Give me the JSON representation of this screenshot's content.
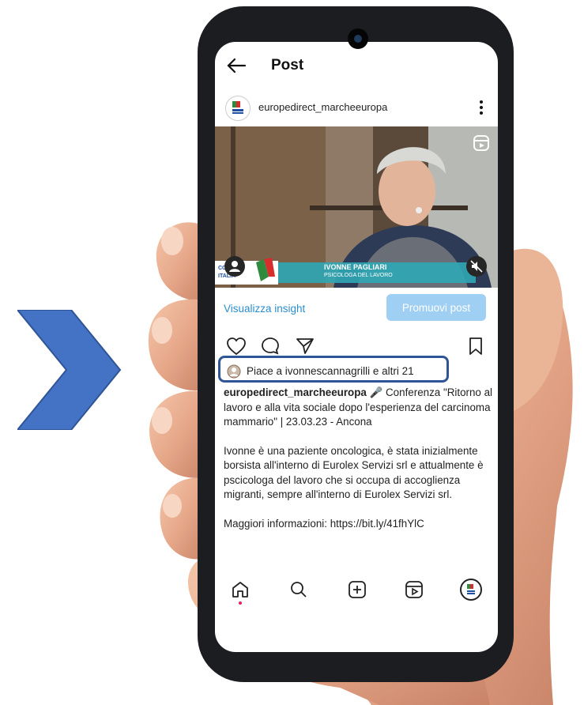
{
  "header": {
    "title": "Post"
  },
  "post": {
    "username": "europedirect_marcheeuropa",
    "video": {
      "lower_third_name": "IVONNE PAGLIARI",
      "lower_third_role": "PSICOLOGA DEL LAVORO",
      "logo_text_1": "COMUNE",
      "logo_text_2": "ITALIA"
    },
    "insight_label": "Visualizza insight",
    "promote_label": "Promuovi post",
    "likes_text": "Piace a ivonnescannagrilli e altri 21",
    "caption": {
      "user": "europedirect_marcheeuropa",
      "p1": "Conferenza \"Ritorno al lavoro e alla vita sociale dopo l'esperienza del carcinoma mammario\" | 23.03.23 - Ancona",
      "p2": "Ivonne è una paziente oncologica, è stata inizialmente borsista all'interno di Eurolex Servizi srl e attualmente è pscicologa del lavoro che si occupa di accoglienza migranti, sempre all'interno di Eurolex Servizi srl.",
      "p3": "Maggiori informazioni: https://bit.ly/41fhYlC"
    }
  },
  "colors": {
    "highlight_border": "#2f5597",
    "chevron": "#4472c4",
    "link": "#2a8ecf",
    "promote_bg": "#9fcff2"
  },
  "icons": [
    "back-arrow-icon",
    "more-vertical-icon",
    "reels-icon",
    "user-tag-icon",
    "mute-icon",
    "heart-icon",
    "comment-icon",
    "share-icon",
    "bookmark-icon",
    "home-icon",
    "search-icon",
    "create-icon",
    "reels-tab-icon",
    "profile-icon"
  ]
}
